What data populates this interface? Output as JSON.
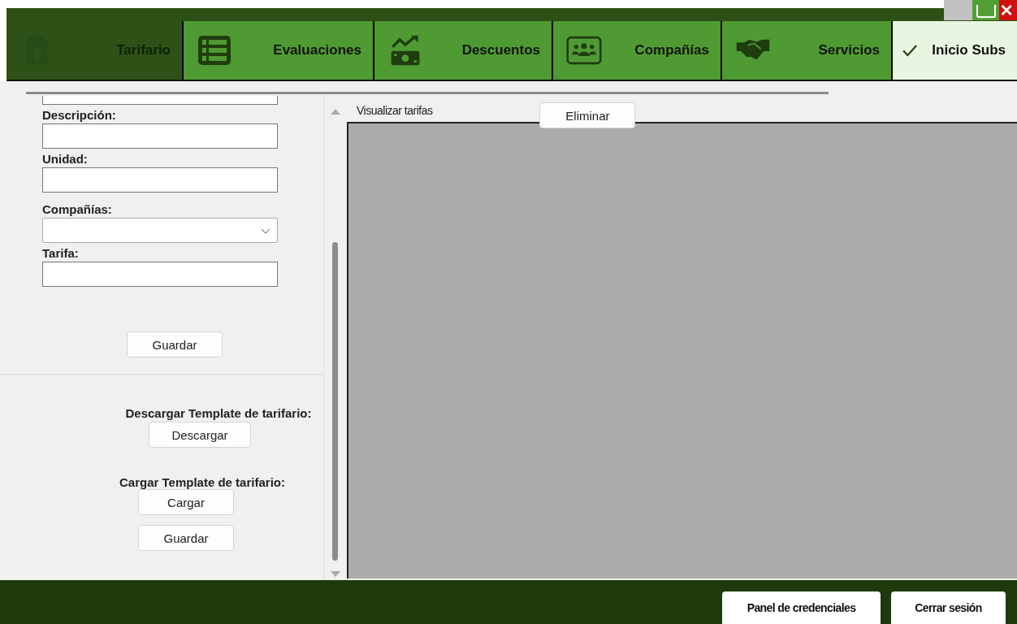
{
  "tabs": [
    {
      "label": "Tarifario",
      "kind": "invoice",
      "selected": false,
      "disabled": true
    },
    {
      "label": "Evaluaciones",
      "kind": "list",
      "selected": false,
      "disabled": false
    },
    {
      "label": "Descuentos",
      "kind": "money",
      "selected": false,
      "disabled": false
    },
    {
      "label": "Compañías",
      "kind": "group",
      "selected": false,
      "disabled": false
    },
    {
      "label": "Servicios",
      "kind": "handshake",
      "selected": false,
      "disabled": false
    },
    {
      "label": "Inicio Subs",
      "kind": "check",
      "selected": true,
      "disabled": false
    }
  ],
  "form": {
    "fields": [
      {
        "label": "Descripción:",
        "kind": "text"
      },
      {
        "label": "Unidad:",
        "kind": "text"
      },
      {
        "label": "Compañías:",
        "kind": "dropdown"
      },
      {
        "label": "Tarifa:",
        "kind": "text"
      }
    ],
    "save_button": "Guardar"
  },
  "template": {
    "download_label": "Descargar Template de tarifario:",
    "download_button": "Descargar",
    "upload_label": "Cargar Template de tarifario:",
    "upload_button": "Cargar",
    "save_button": "Guardar"
  },
  "viewer": {
    "title": "Visualizar tarifas",
    "delete_button": "Eliminar"
  },
  "footer": {
    "buttons": [
      "Panel de credenciales",
      "Cerrar sesión"
    ]
  }
}
